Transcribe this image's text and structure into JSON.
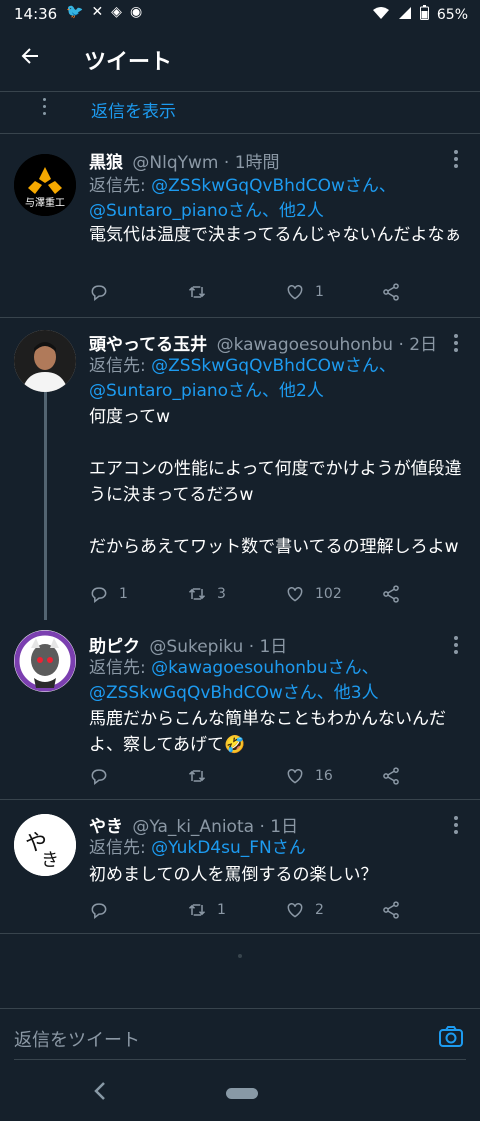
{
  "status_bar": {
    "time": "14:36",
    "battery": "65%"
  },
  "header": {
    "title": "ツイート"
  },
  "show_replies": "返信を表示",
  "reply_prefix": "返信先:",
  "tweets": [
    {
      "name": "黒狼",
      "handle": "@NlqYwm",
      "time": "· 1時間",
      "reply_line1": "@ZSSkwGqQvBhdCOwさん、",
      "reply_line2": "@Suntaro_pianoさん、他2人",
      "text": "電気代は温度で決まってるんじゃないんだよなぁ",
      "replies": "",
      "retweets": "",
      "likes": "1"
    },
    {
      "name": "頭やってる玉井",
      "handle": "@kawagoesouhonbu",
      "time": "· 2日",
      "reply_line1": "@ZSSkwGqQvBhdCOwさん、",
      "reply_line2": "@Suntaro_pianoさん、他2人",
      "text": "何度ってw\n\nエアコンの性能によって何度でかけようが値段違うに決まってるだろw\n\nだからあえてワット数で書いてるの理解しろよw",
      "replies": "1",
      "retweets": "3",
      "likes": "102"
    },
    {
      "name": "助ピク",
      "handle": "@Sukepiku",
      "time": "· 1日",
      "reply_line1": "@kawagoesouhonbuさん、",
      "reply_line2": "@ZSSkwGqQvBhdCOwさん、他3人",
      "text": "馬鹿だからこんな簡単なこともわかんないんだよ、察してあげて🤣",
      "replies": "",
      "retweets": "",
      "likes": "16"
    },
    {
      "name": "やき",
      "handle": "@Ya_ki_Aniota",
      "time": "· 1日",
      "reply_line1": "@YukD4su_FNさん",
      "reply_line2": "",
      "text": "初めましての人を罵倒するの楽しい？",
      "replies": "",
      "retweets": "1",
      "likes": "2"
    }
  ],
  "composer": {
    "placeholder": "返信をツイート"
  },
  "icons": {
    "reply": "reply-icon",
    "retweet": "retweet-icon",
    "like": "heart-icon",
    "share": "share-icon",
    "camera": "camera-icon",
    "back": "back-arrow-icon"
  },
  "colors": {
    "background": "#15202b",
    "accent": "#1d9bf0",
    "muted": "#8b98a5",
    "divider": "#38444d"
  }
}
